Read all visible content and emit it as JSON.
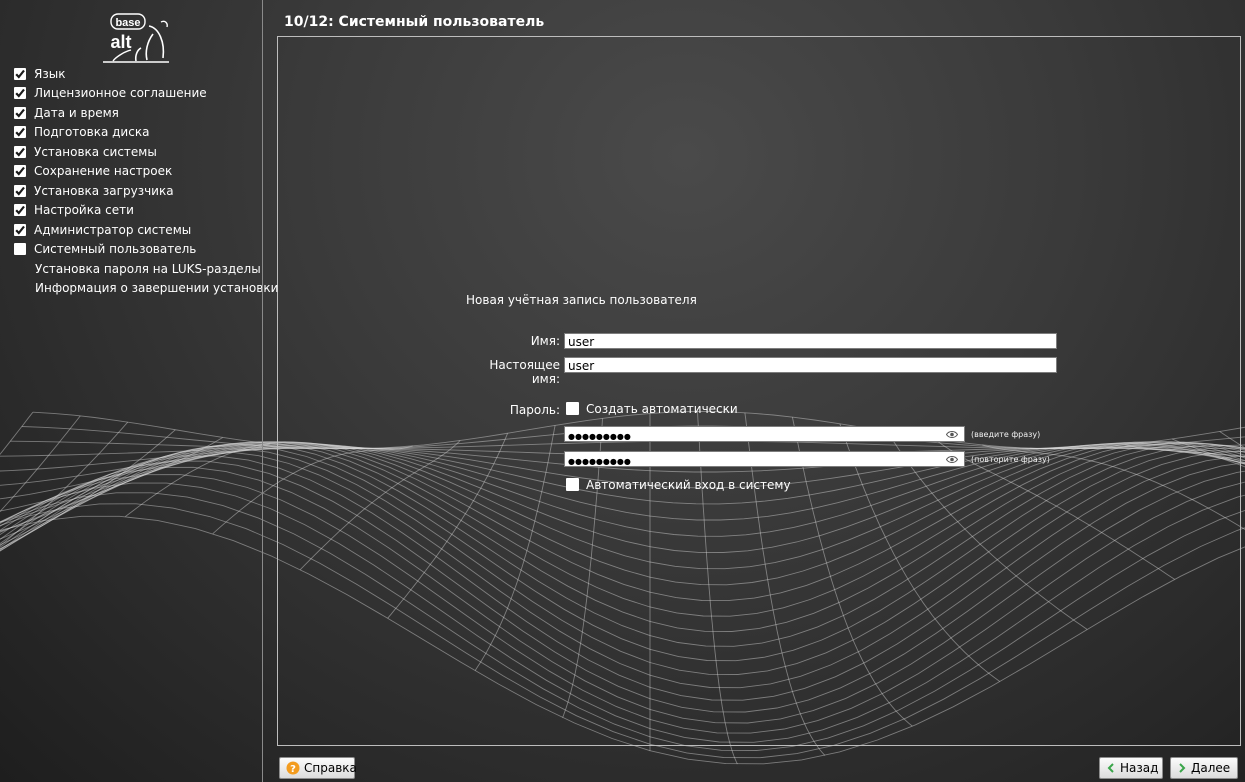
{
  "logo": {
    "top": "base",
    "bottom": "alt"
  },
  "page": {
    "title": "10/12: Системный пользователь"
  },
  "steps": [
    {
      "label": "Язык",
      "done": true
    },
    {
      "label": "Лицензионное соглашение",
      "done": true
    },
    {
      "label": "Дата и время",
      "done": true
    },
    {
      "label": "Подготовка диска",
      "done": true
    },
    {
      "label": "Установка системы",
      "done": true
    },
    {
      "label": "Сохранение настроек",
      "done": true
    },
    {
      "label": "Установка загрузчика",
      "done": true
    },
    {
      "label": "Настройка сети",
      "done": true
    },
    {
      "label": "Администратор системы",
      "done": true
    },
    {
      "label": "Системный пользователь",
      "done": false,
      "current": true
    },
    {
      "label": "Установка пароля на LUKS-разделы",
      "done": false
    },
    {
      "label": "Информация о завершении установки",
      "done": false
    }
  ],
  "form": {
    "section_title": "Новая учётная запись пользователя",
    "name_label": "Имя:",
    "name_value": "user",
    "realname_label": "Настоящее имя:",
    "realname_value": "user",
    "password_label": "Пароль:",
    "auto_password_label": "Создать автоматически",
    "auto_password_checked": false,
    "password_value": "●●●●●●●●●",
    "password_hint": "(введите фразу)",
    "password_repeat_value": "●●●●●●●●●",
    "password_repeat_hint": "(повторите фразу)",
    "autologin_label": "Автоматический вход в систему",
    "autologin_checked": false
  },
  "buttons": {
    "help": "Справка",
    "back": "Назад",
    "next": "Далее"
  },
  "icons": {
    "help": "help-icon",
    "back": "arrow-left-icon",
    "next": "arrow-right-icon",
    "eye": "eye-icon",
    "check": "check-icon"
  },
  "colors": {
    "checkmark": "#1a1a1a",
    "help_icon": "#f39c1f",
    "nav_arrow": "#3aa54a"
  }
}
